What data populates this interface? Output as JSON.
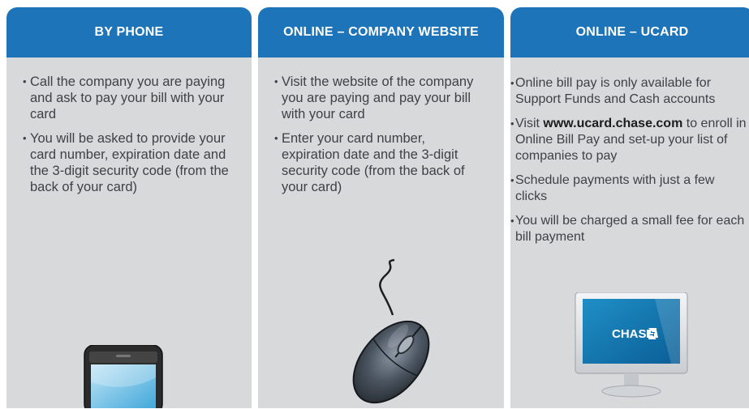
{
  "panels": [
    {
      "header": "BY PHONE",
      "bullets": [
        "Call the company you are paying and ask to pay your bill with your card",
        "You will be asked to provide your card number, expiration date and the 3-digit security code (from the back of your card)"
      ],
      "illustration": "mobile-phone-icon"
    },
    {
      "header": "ONLINE – COMPANY WEBSITE",
      "bullets": [
        "Visit the website of the company you are paying and pay your bill with your card",
        "Enter your card number, expiration date and the 3-digit security code (from the back of your card)"
      ],
      "illustration": "computer-mouse-icon"
    },
    {
      "header": "ONLINE – UCARD",
      "bullets": {
        "b1": "Online bill pay is only available for Support Funds and Cash accounts",
        "b2_pre": "Visit ",
        "b2_link": "www.ucard.chase.com",
        "b2_post": " to enroll in Online Bill Pay and set-up your list of companies to pay",
        "b3": "Schedule payments with just a few clicks",
        "b4": "You will be charged a small fee for each bill payment"
      },
      "illustration": "computer-monitor-icon",
      "screen_logo": "CHASE"
    }
  ],
  "colors": {
    "header_blue": "#1d74b8",
    "panel_gray": "#d8d9db",
    "text": "#3e4145"
  }
}
